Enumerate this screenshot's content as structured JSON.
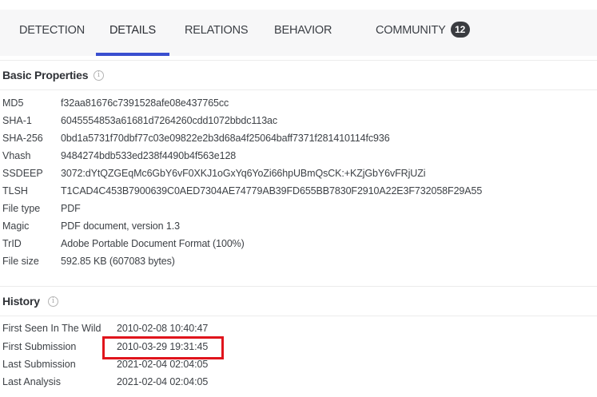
{
  "tabs": [
    {
      "label": "DETECTION"
    },
    {
      "label": "DETAILS"
    },
    {
      "label": "RELATIONS"
    },
    {
      "label": "BEHAVIOR"
    },
    {
      "label": "COMMUNITY",
      "badge": "12"
    }
  ],
  "active_tab": "DETAILS",
  "basic_properties": {
    "title": "Basic Properties",
    "info_icon": "info-circle-icon",
    "rows": [
      {
        "key": "MD5",
        "value": "f32aa81676c7391528afe08e437765cc"
      },
      {
        "key": "SHA-1",
        "value": "6045554853a61681d7264260cdd1072bbdc113ac"
      },
      {
        "key": "SHA-256",
        "value": "0bd1a5731f70dbf77c03e09822e2b3d68a4f25064baff7371f281410114fc936"
      },
      {
        "key": "Vhash",
        "value": "9484274bdb533ed238f4490b4f563e128"
      },
      {
        "key": "SSDEEP",
        "value": "3072:dYtQZGEqMc6GbY6vF0XKJ1oGxYq6YoZi66hpUBmQsCK:+KZjGbY6vFRjUZi"
      },
      {
        "key": "TLSH",
        "value": "T1CAD4C453B7900639C0AED7304AE74779AB39FD655BB7830F2910A22E3F732058F29A55"
      },
      {
        "key": "File type",
        "value": "PDF"
      },
      {
        "key": "Magic",
        "value": "PDF document, version 1.3"
      },
      {
        "key": "TrID",
        "value": "Adobe Portable Document Format (100%)"
      },
      {
        "key": "File size",
        "value": "592.85 KB (607083 bytes)"
      }
    ]
  },
  "history": {
    "title": "History",
    "info_icon": "info-circle-icon",
    "rows": [
      {
        "key": "First Seen In The Wild",
        "value": "2010-02-08 10:40:47"
      },
      {
        "key": "First Submission",
        "value": "2010-03-29 19:31:45"
      },
      {
        "key": "Last Submission",
        "value": "2021-02-04 02:04:05"
      },
      {
        "key": "Last Analysis",
        "value": "2021-02-04 02:04:05"
      }
    ]
  },
  "colors": {
    "active_tab_underline": "#3a4fd0",
    "highlight_box": "#e0141c",
    "badge_bg": "#3a3c40"
  }
}
